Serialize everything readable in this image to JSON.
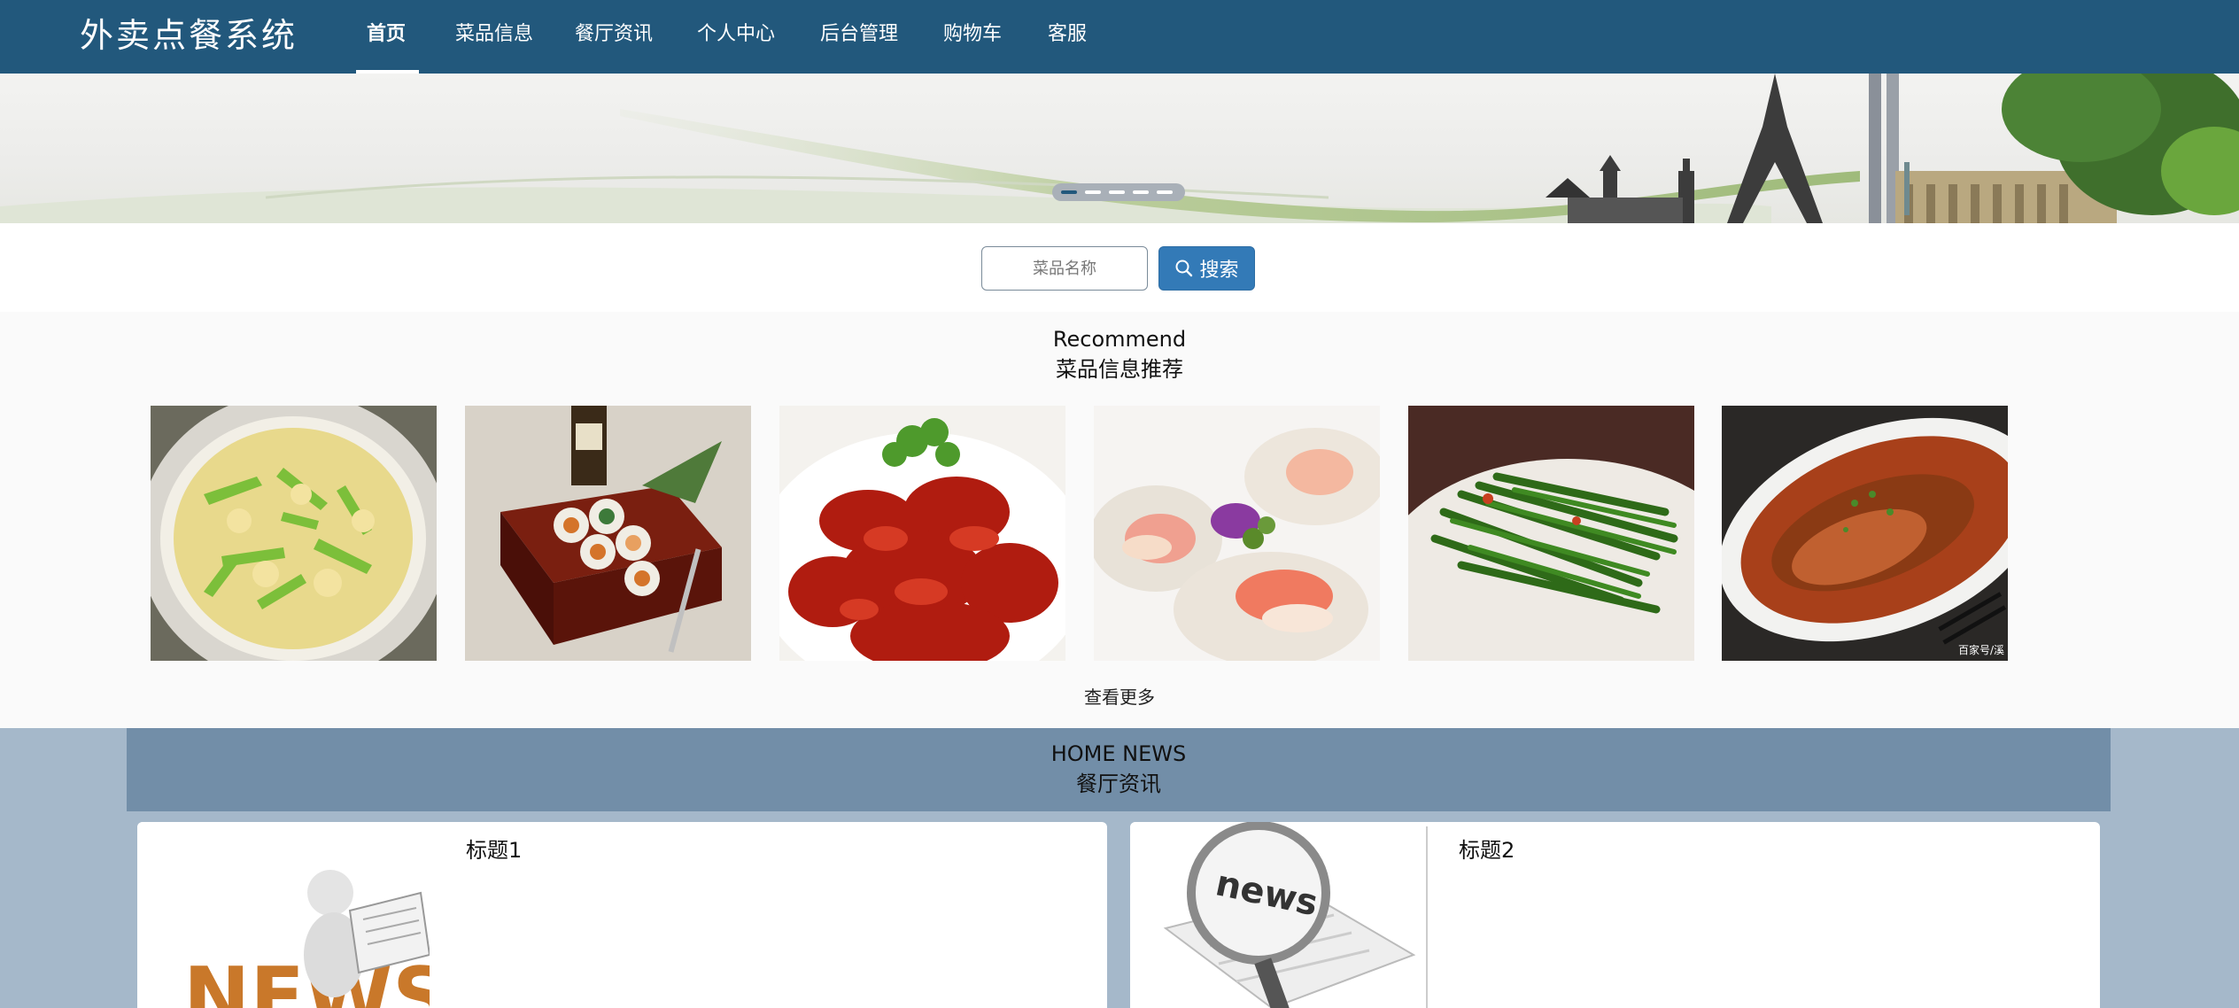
{
  "header": {
    "brand": "外卖点餐系统",
    "nav": [
      {
        "label": "首页",
        "active": true
      },
      {
        "label": "菜品信息"
      },
      {
        "label": "餐厅资讯"
      },
      {
        "label": "个人中心"
      },
      {
        "label": "后台管理"
      },
      {
        "label": "购物车"
      },
      {
        "label": "客服"
      }
    ]
  },
  "banner": {
    "slide_count": 5,
    "active_slide": 1
  },
  "search": {
    "placeholder": "菜品名称",
    "button_label": "搜索",
    "icon": "search-icon"
  },
  "recommend": {
    "title_en": "Recommend",
    "title_cn": "菜品信息推荐",
    "items": [
      {
        "image": "stir-fried-egg-green-pepper"
      },
      {
        "image": "sushi-box"
      },
      {
        "image": "red-crayfish"
      },
      {
        "image": "scallops"
      },
      {
        "image": "stir-fried-greens"
      },
      {
        "image": "braised-fish",
        "watermark": "百家号/溪"
      }
    ],
    "more_label": "查看更多"
  },
  "news": {
    "title_en": "HOME NEWS",
    "title_cn": "餐厅资讯",
    "items": [
      {
        "title": "标题1",
        "image": "news-reader-figure"
      },
      {
        "title": "标题2",
        "image": "news-magnifier"
      }
    ]
  },
  "colors": {
    "navbar": "#22587c",
    "accent": "#337ab7",
    "news_bg": "#a5b8ca",
    "news_header": "#728ea8"
  }
}
